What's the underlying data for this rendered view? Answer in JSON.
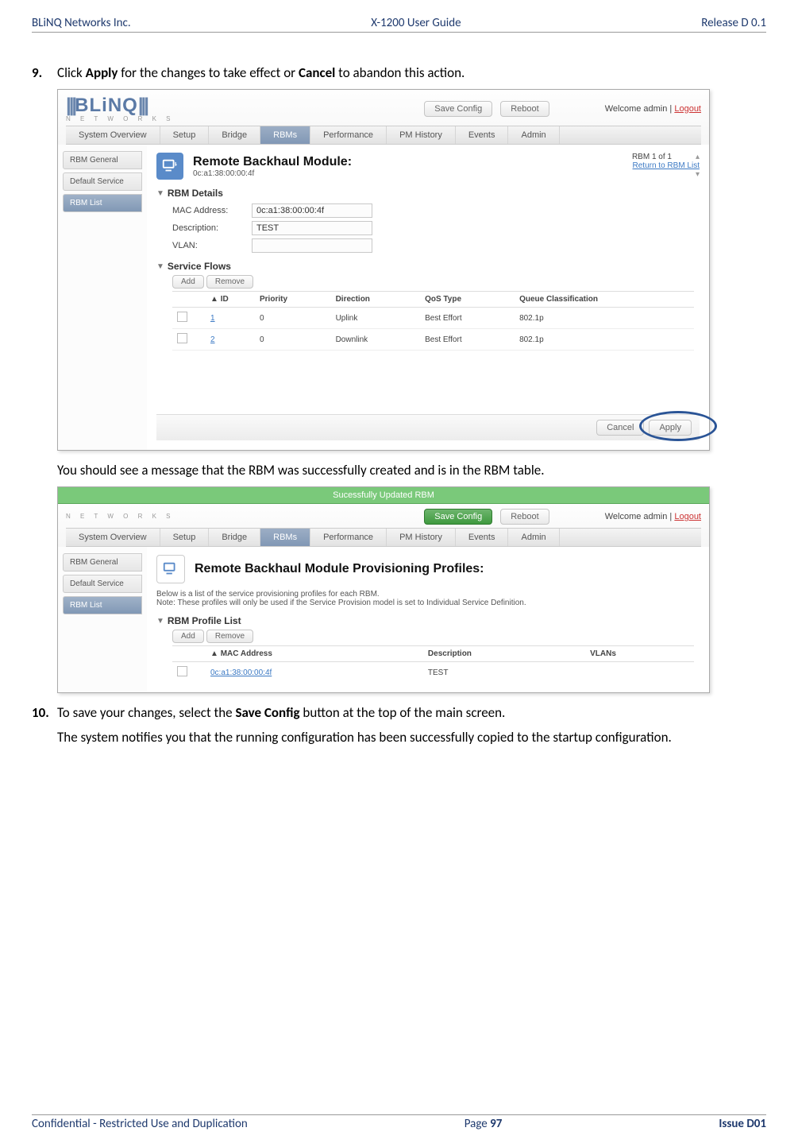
{
  "doc": {
    "header_left": "BLiNQ Networks Inc.",
    "header_center": "X-1200 User Guide",
    "header_right": "Release D 0.1",
    "footer_left": "Confidential - Restricted Use and Duplication",
    "footer_center_prefix": "Page ",
    "footer_center_num": "97",
    "footer_right": "Issue D01"
  },
  "instr9": {
    "num": "9.",
    "pre": "Click ",
    "b1": "Apply",
    "mid": " for the changes to take effect or ",
    "b2": "Cancel",
    "post": " to abandon this action."
  },
  "after9": "You should see a message that the RBM was successfully created and is in the RBM table.",
  "instr10": {
    "num": "10.",
    "pre": "To save your changes, select the ",
    "b1": "Save Config",
    "post": " button at the top of the main screen."
  },
  "after10": "The system notifies you that the running configuration has been successfully copied to the startup configuration.",
  "ui": {
    "brand": "BLiNQ",
    "brand_sub": "N E T W O R K S",
    "save_config": "Save Config",
    "reboot": "Reboot",
    "welcome_prefix": "Welcome admin  |  ",
    "logout": "Logout",
    "nav": [
      "System Overview",
      "Setup",
      "Bridge",
      "RBMs",
      "Performance",
      "PM History",
      "Events",
      "Admin"
    ],
    "sidebar": [
      "RBM General",
      "Default Service",
      "RBM List"
    ],
    "cancel": "Cancel",
    "apply": "Apply",
    "add": "Add",
    "remove": "Remove"
  },
  "shot1": {
    "title": "Remote Backhaul Module:",
    "mac": "0c:a1:38:00:00:4f",
    "counter": "RBM 1 of 1",
    "return": "Return to RBM List",
    "sec_details": "RBM Details",
    "lbl_mac": "MAC Address:",
    "val_mac": "0c:a1:38:00:00:4f",
    "lbl_desc": "Description:",
    "val_desc": "TEST",
    "lbl_vlan": "VLAN:",
    "val_vlan": "",
    "sec_flows": "Service Flows",
    "cols": {
      "id": "ID",
      "prio": "Priority",
      "dir": "Direction",
      "qos": "QoS Type",
      "qc": "Queue Classification",
      "arrow": "▲"
    },
    "rows": [
      {
        "id": "1",
        "prio": "0",
        "dir": "Uplink",
        "qos": "Best Effort",
        "qc": "802.1p"
      },
      {
        "id": "2",
        "prio": "0",
        "dir": "Downlink",
        "qos": "Best Effort",
        "qc": "802.1p"
      }
    ]
  },
  "shot2": {
    "success": "Sucessfully Updated RBM",
    "title": "Remote Backhaul Module Provisioning Profiles:",
    "desc1": "Below is a list of the service provisioning profiles for each RBM.",
    "desc2": "Note: These profiles will only be used if the Service Provision model is set to Individual Service Definition.",
    "sec": "RBM Profile List",
    "cols": {
      "mac": "MAC Address",
      "desc": "Description",
      "vlans": "VLANs",
      "arrow": "▲"
    },
    "rows": [
      {
        "mac": "0c:a1:38:00:00:4f",
        "desc": "TEST",
        "vlans": ""
      }
    ]
  }
}
